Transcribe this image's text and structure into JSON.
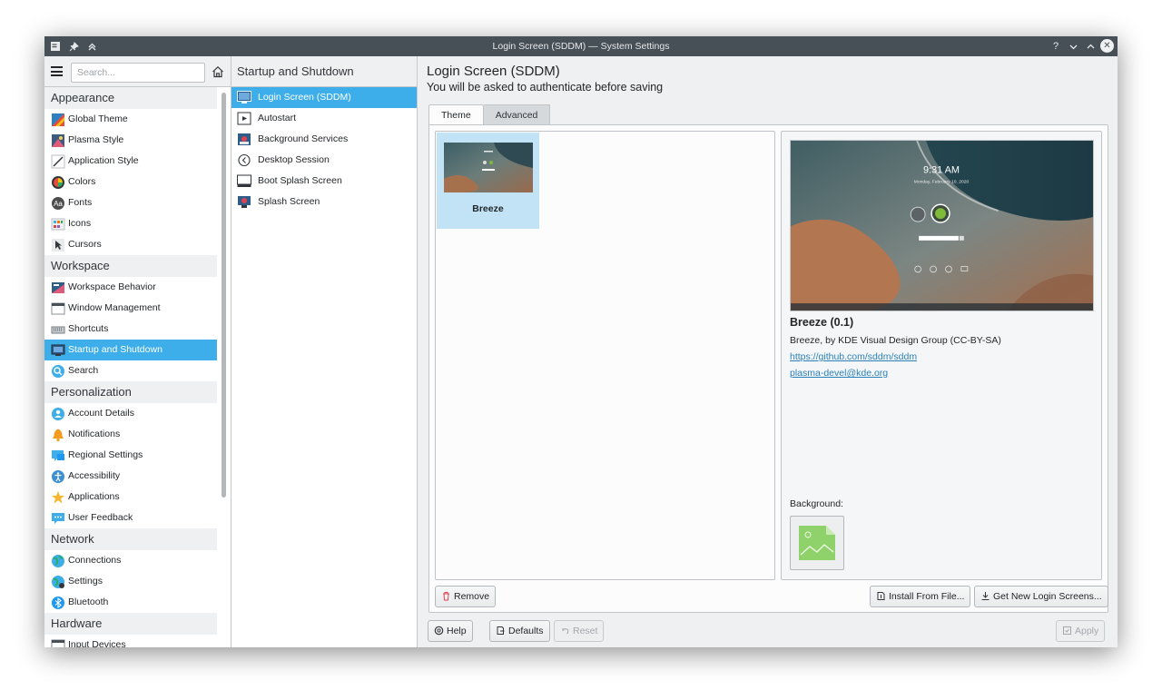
{
  "window": {
    "title": "Login Screen (SDDM) — System Settings"
  },
  "search": {
    "placeholder": "Search..."
  },
  "sidebar": {
    "categories": [
      {
        "label": "Appearance",
        "items": [
          {
            "label": "Global Theme",
            "icon": "global-theme-icon"
          },
          {
            "label": "Plasma Style",
            "icon": "plasma-style-icon"
          },
          {
            "label": "Application Style",
            "icon": "application-style-icon"
          },
          {
            "label": "Colors",
            "icon": "colors-icon"
          },
          {
            "label": "Fonts",
            "icon": "fonts-icon"
          },
          {
            "label": "Icons",
            "icon": "icons-icon"
          },
          {
            "label": "Cursors",
            "icon": "cursors-icon"
          }
        ]
      },
      {
        "label": "Workspace",
        "items": [
          {
            "label": "Workspace Behavior",
            "icon": "workspace-behavior-icon"
          },
          {
            "label": "Window Management",
            "icon": "window-management-icon"
          },
          {
            "label": "Shortcuts",
            "icon": "keyboard-icon"
          },
          {
            "label": "Startup and Shutdown",
            "icon": "startup-icon",
            "selected": true
          },
          {
            "label": "Search",
            "icon": "search-icon"
          }
        ]
      },
      {
        "label": "Personalization",
        "items": [
          {
            "label": "Account Details",
            "icon": "account-icon"
          },
          {
            "label": "Notifications",
            "icon": "bell-icon"
          },
          {
            "label": "Regional Settings",
            "icon": "regional-icon"
          },
          {
            "label": "Accessibility",
            "icon": "accessibility-icon"
          },
          {
            "label": "Applications",
            "icon": "star-icon"
          },
          {
            "label": "User Feedback",
            "icon": "feedback-icon"
          }
        ]
      },
      {
        "label": "Network",
        "items": [
          {
            "label": "Connections",
            "icon": "globe-icon"
          },
          {
            "label": "Settings",
            "icon": "globe-settings-icon"
          },
          {
            "label": "Bluetooth",
            "icon": "bluetooth-icon"
          }
        ]
      },
      {
        "label": "Hardware",
        "items": [
          {
            "label": "Input Devices",
            "icon": "input-devices-icon"
          }
        ]
      }
    ]
  },
  "middle": {
    "title": "Startup and Shutdown",
    "items": [
      {
        "label": "Login Screen (SDDM)",
        "icon": "monitor-icon",
        "selected": true
      },
      {
        "label": "Autostart",
        "icon": "autostart-icon"
      },
      {
        "label": "Background Services",
        "icon": "services-icon"
      },
      {
        "label": "Desktop Session",
        "icon": "session-icon"
      },
      {
        "label": "Boot Splash Screen",
        "icon": "boot-splash-icon"
      },
      {
        "label": "Splash Screen",
        "icon": "splash-icon"
      }
    ]
  },
  "main": {
    "title": "Login Screen (SDDM)",
    "subtitle": "You will be asked to authenticate before saving",
    "tabs": [
      {
        "label": "Theme",
        "active": true
      },
      {
        "label": "Advanced",
        "active": false
      }
    ],
    "themes": [
      {
        "name": "Breeze",
        "selected": true
      }
    ],
    "detail": {
      "name": "Breeze (0.1)",
      "author": "Breeze, by KDE Visual Design Group (CC-BY-SA)",
      "website": "https://github.com/sddm/sddm",
      "email": "plasma-devel@kde.org",
      "background_label": "Background:",
      "preview_time": "9:31 AM",
      "preview_date": "Monday, February 10, 2020"
    },
    "buttons": {
      "remove": "Remove",
      "install": "Install From File...",
      "get_new": "Get New Login Screens..."
    }
  },
  "footer": {
    "help": "Help",
    "defaults": "Defaults",
    "reset": "Reset",
    "apply": "Apply"
  },
  "colors": {
    "accent": "#3daee9",
    "titlebar": "#475057",
    "window_bg": "#eff0f1"
  }
}
